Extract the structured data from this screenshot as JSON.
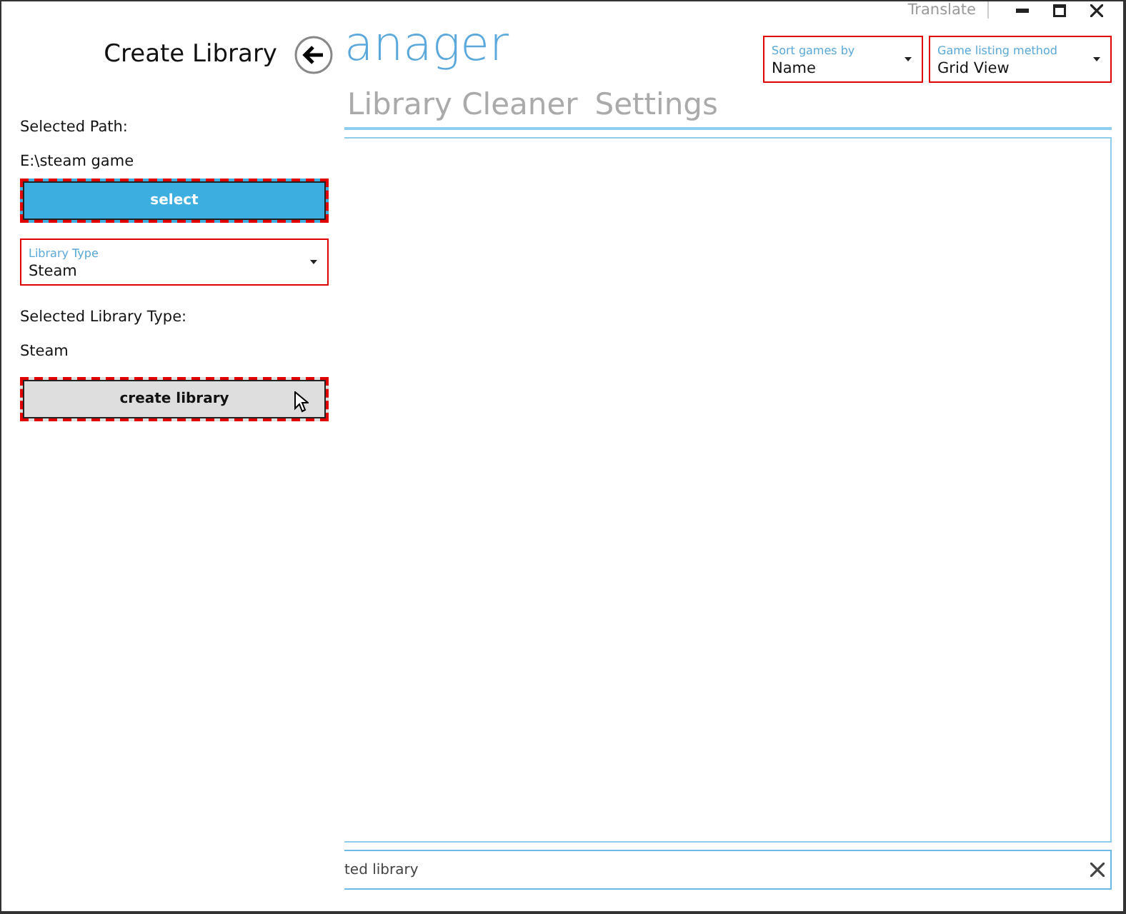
{
  "title": "anager",
  "title_bar": {
    "translate": "Translate"
  },
  "sort": {
    "label": "Sort games by",
    "value": "Name"
  },
  "listing": {
    "label": "Game listing method",
    "value": "Grid View"
  },
  "tabs": [
    "Library Cleaner",
    "Settings"
  ],
  "status": {
    "text": "ted library"
  },
  "flyout": {
    "title": "Create Library",
    "path_label": "Selected Path:",
    "path": "E:\\steam game",
    "select_button": "select",
    "library_type": {
      "label": "Library Type",
      "value": "Steam"
    },
    "type_label": "Selected Library Type:",
    "type_value": "Steam",
    "create_button": "create library"
  }
}
